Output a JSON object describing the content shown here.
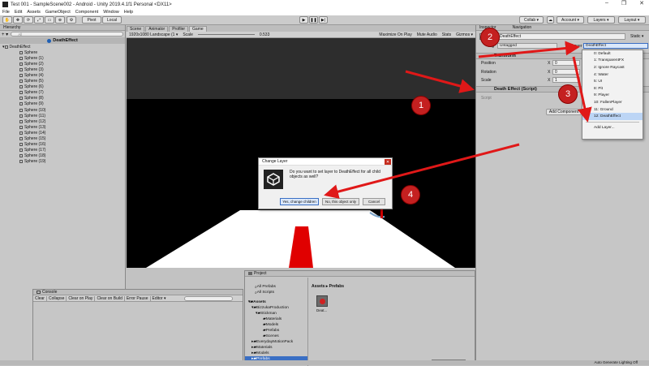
{
  "window": {
    "title": "Test 001 - SampleScene002 - Android - Unity 2019.4.1f1 Personal <DX11>",
    "controls": [
      "–",
      "❐",
      "✕"
    ]
  },
  "menu": [
    "File",
    "Edit",
    "Assets",
    "GameObject",
    "Component",
    "Window",
    "Help"
  ],
  "toolbar": {
    "pivot": "Pivot",
    "local": "Local",
    "collab": "Collab ▾",
    "account": "Account ▾",
    "layers": "Layers ▾",
    "layout": "Layout ▾"
  },
  "hierarchy": {
    "tab": "Hierarchy",
    "search_placeholder": "All",
    "scene": "DeathEffect",
    "root": "DeathEffect",
    "children": [
      "Sphere",
      "Sphere (1)",
      "Sphere (2)",
      "Sphere (3)",
      "Sphere (4)",
      "Sphere (5)",
      "Sphere (6)",
      "Sphere (7)",
      "Sphere (8)",
      "Sphere (9)",
      "Sphere (10)",
      "Sphere (11)",
      "Sphere (12)",
      "Sphere (13)",
      "Sphere (14)",
      "Sphere (15)",
      "Sphere (16)",
      "Sphere (17)",
      "Sphere (18)",
      "Sphere (19)"
    ]
  },
  "scene_tabs": [
    "Scene",
    "Animator",
    "Profiler",
    "Game"
  ],
  "gamebar": {
    "resolution": "1920x1080 Landscape (1 ▾",
    "scale_label": "Scale",
    "scale_value": "0.533",
    "maximize": "Maximize On Play",
    "mute": "Mute Audio",
    "stats": "Stats",
    "gizmos": "Gizmos ▾"
  },
  "dialog": {
    "title": "Change Layer",
    "message": "Do you want to set layer to DeathEffect for all child objects as well?",
    "yes": "Yes, change children",
    "no": "No, this object only",
    "cancel": "Cancel"
  },
  "inspector": {
    "tab1": "Inspector",
    "tab2": "Navigation",
    "object_name": "DeathEffect",
    "static_label": "Static ▾",
    "tag_label": "Tag",
    "tag_value": "Untagged",
    "layer_label": "Layer",
    "layer_value": "DeathEffect",
    "transform": "Transform",
    "position": "Position",
    "rotation": "Rotation",
    "scale": "Scale",
    "x_label": "X",
    "pos_x": "0",
    "rot_x": "0",
    "scale_x": "1",
    "script_component": "Death Effect (Script)",
    "script_label": "Script",
    "add_component": "Add Component"
  },
  "layers_dropdown": {
    "items": [
      "0: Default",
      "1: TransparentFX",
      "2: Ignore Raycast",
      "4: Water",
      "5: UI",
      "8: Pit",
      "9: Player",
      "10: FallenPlayer",
      "11: Ground",
      "12: DeathEffect"
    ],
    "selected": "12: DeathEffect",
    "check": "✓",
    "add": "Add Layer..."
  },
  "console": {
    "tab": "Console",
    "buttons": [
      "Clear",
      "Collapse",
      "Clear on Play",
      "Clear on Build",
      "Error Pause",
      "Editor ▾"
    ]
  },
  "project": {
    "tab": "Project",
    "favorites": [
      "All Prefabs",
      "All Scripts"
    ],
    "tree": [
      "Assets",
      "BizzukaProduction",
      "Stickman",
      "Materials",
      "Models",
      "Prefabs",
      "Scenes",
      "EverydayMotionPack",
      "Materials",
      "Models",
      "Prefabs"
    ],
    "breadcrumb": "Assets ▸ Prefabs",
    "asset": "Deat..."
  },
  "status": "Auto Generate Lighting Off",
  "annotations": [
    "1",
    "2",
    "3",
    "4"
  ],
  "colors": {
    "arrow": "#e01818",
    "selection": "#bcd5f5"
  }
}
